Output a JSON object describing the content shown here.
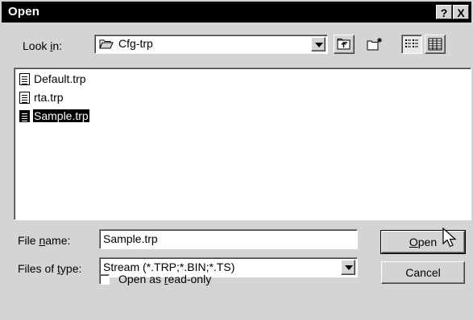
{
  "window": {
    "title": "Open",
    "help_label": "?",
    "close_label": "X"
  },
  "lookin": {
    "label_pre": "Look ",
    "label_mnemonic": "i",
    "label_post": "n:",
    "folder": "Cfg-trp"
  },
  "toolbar": {
    "up_icon": "up-folder-icon",
    "new_folder_icon": "new-folder-icon",
    "list_icon": "list-view-icon",
    "details_icon": "details-view-icon"
  },
  "files": [
    {
      "name": "Default.trp",
      "selected": false
    },
    {
      "name": "rta.trp",
      "selected": false
    },
    {
      "name": "Sample.trp",
      "selected": true
    }
  ],
  "filename": {
    "label_pre": "File ",
    "label_mnemonic": "n",
    "label_post": "ame:",
    "value": "Sample.trp"
  },
  "filetype": {
    "label_pre": "Files of ",
    "label_mnemonic": "t",
    "label_post": "ype:",
    "value": "Stream (*.TRP;*.BIN;*.TS)"
  },
  "readonly": {
    "label_pre": "Open as ",
    "label_mnemonic": "r",
    "label_post": "ead-only",
    "checked": false
  },
  "buttons": {
    "open_mnemonic": "O",
    "open_rest": "pen",
    "cancel": "Cancel"
  }
}
